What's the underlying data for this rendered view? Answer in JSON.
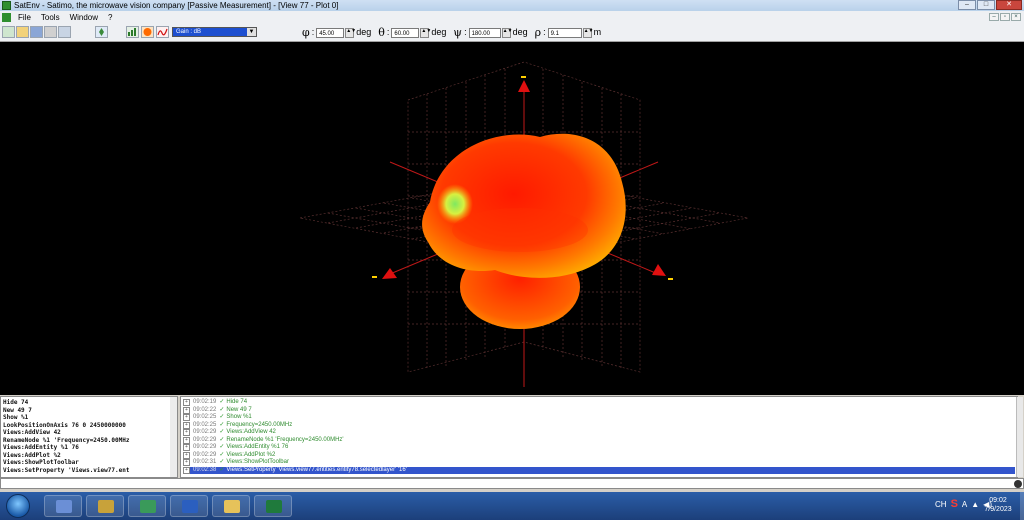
{
  "window": {
    "title": "SatEnv - Satimo, the microwave vision company  [Passive Measurement] - [View 77 - Plot 0]",
    "min_glyph": "–",
    "max_glyph": "□",
    "close_glyph": "✕"
  },
  "menu": {
    "items": [
      "File",
      "Tools",
      "Window",
      "?"
    ]
  },
  "mdi_buttons": [
    "–",
    "▫",
    "×"
  ],
  "toolbar": {
    "gain_select": "Gain : dB",
    "phi": {
      "symbol": "φ",
      "value": "45.00",
      "unit": "deg"
    },
    "theta": {
      "symbol": "θ",
      "value": "60.00",
      "unit": "deg"
    },
    "psi": {
      "symbol": "ψ",
      "value": "180.00",
      "unit": "deg"
    },
    "rho": {
      "symbol": "ρ",
      "value": "9.1",
      "unit": "m"
    }
  },
  "viewport": {
    "background": "#000000",
    "grid_color": "#5a3030",
    "axis_color": "#c01818",
    "pattern_core": "#ff2a00",
    "pattern_edge": "#ffb000"
  },
  "command_history": [
    "Hide 74",
    "New 49 7",
    "Show %1",
    "LookPositionOnAxis 76 0 2450000000",
    "Views:AddView 42",
    "RenameNode %1 'Frequency=2450.00MHz",
    "Views:AddEntity %1 76",
    "Views:AddPlot %2",
    "Views:ShowPlotToolbar",
    "Views:SetProperty 'Views.view77.ent"
  ],
  "log": [
    {
      "time": "09:02:19",
      "text": "Hide 74"
    },
    {
      "time": "09:02:22",
      "text": "New 49 7"
    },
    {
      "time": "09:02:25",
      "text": "Show %1"
    },
    {
      "time": "09:02:25",
      "text": "Frequency=2450.00MHz"
    },
    {
      "time": "09:02:29",
      "text": "Views:AddView 42"
    },
    {
      "time": "09:02:29",
      "text": "RenameNode %1 'Frequency=2450.00MHz'"
    },
    {
      "time": "09:02:29",
      "text": "Views:AddEntity %1 76"
    },
    {
      "time": "09:02:29",
      "text": "Views:AddPlot %2"
    },
    {
      "time": "09:02:31",
      "text": "Views:ShowPlotToolbar"
    },
    {
      "time": "09:02:38",
      "text": "Views:SetProperty 'Views.view77.entities.entity78.selectedlayer' '16'"
    }
  ],
  "taskbar": {
    "apps": [
      {
        "name": "satenv-app",
        "color": "#6b8fd6"
      },
      {
        "name": "satimo-app",
        "color": "#c8a23a"
      },
      {
        "name": "monitor-app",
        "color": "#3a9a5a"
      },
      {
        "name": "word-app",
        "color": "#2b5fbf"
      },
      {
        "name": "explorer-app",
        "color": "#e6c25a"
      },
      {
        "name": "excel-app",
        "color": "#1f7a3c"
      }
    ],
    "tray_lang": "CH",
    "tray_text": "A",
    "clock_time": "09:02",
    "clock_date": "7/9/2023"
  }
}
